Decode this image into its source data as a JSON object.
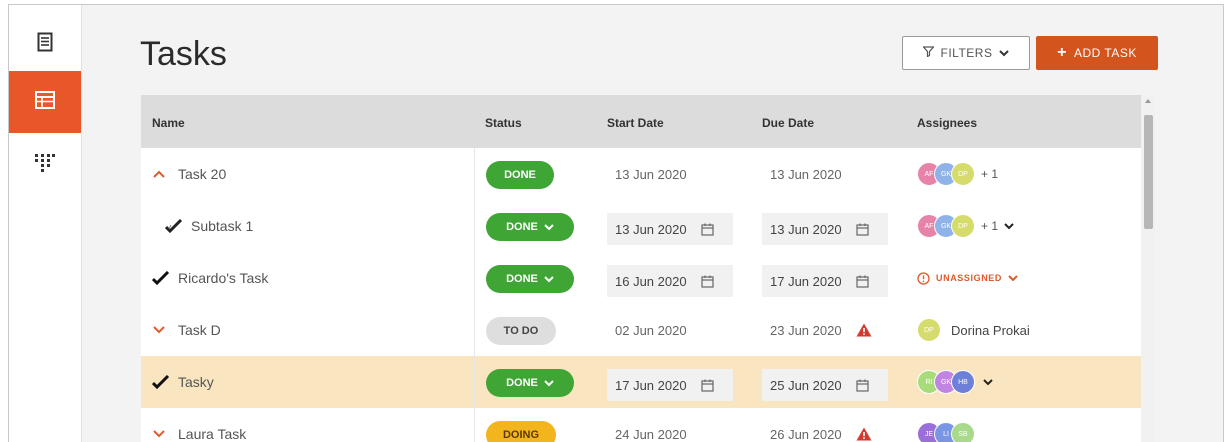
{
  "page": {
    "title": "Tasks"
  },
  "nav": [
    {
      "icon": "document-icon",
      "active": false
    },
    {
      "icon": "table-icon",
      "active": true
    },
    {
      "icon": "grid-icon",
      "active": false
    }
  ],
  "toolbar": {
    "filters_label": "FILTERS",
    "add_label": "ADD TASK"
  },
  "table": {
    "headers": {
      "name": "Name",
      "status": "Status",
      "start": "Start Date",
      "due": "Due Date",
      "assignees": "Assignees"
    },
    "rows": [
      {
        "name": "Task 20",
        "status": "DONE",
        "start": "13 Jun 2020",
        "due": "13 Jun 2020",
        "avatars": [
          "AF",
          "GK",
          "DP"
        ],
        "more": "+ 1"
      },
      {
        "name": "Subtask 1",
        "status": "DONE",
        "start": "13 Jun 2020",
        "due": "13 Jun 2020",
        "avatars": [
          "AF",
          "GK",
          "DP"
        ],
        "more": "+ 1"
      },
      {
        "name": "Ricardo's Task",
        "status": "DONE",
        "start": "16 Jun 2020",
        "due": "17 Jun 2020",
        "unassigned": "UNASSIGNED"
      },
      {
        "name": "Task D",
        "status": "TO DO",
        "start": "02 Jun 2020",
        "due": "23 Jun 2020",
        "avatars": [
          "DP"
        ],
        "person": "Dorina Prokai"
      },
      {
        "name": "Tasky",
        "status": "DONE",
        "start": "17 Jun 2020",
        "due": "25 Jun 2020",
        "avatars": [
          "RI",
          "GK",
          "HB"
        ]
      },
      {
        "name": "Laura Task",
        "status": "DOING",
        "start": "24 Jun 2020",
        "due": "26 Jun 2020",
        "avatars": [
          "JE",
          "LI",
          "SB"
        ]
      }
    ]
  },
  "colors": {
    "accent": "#e8572a",
    "done": "#3fa535",
    "doing": "#f3b51d",
    "todo": "#dedede",
    "highlight": "#f9e6c0",
    "warning": "#d63a2e"
  }
}
